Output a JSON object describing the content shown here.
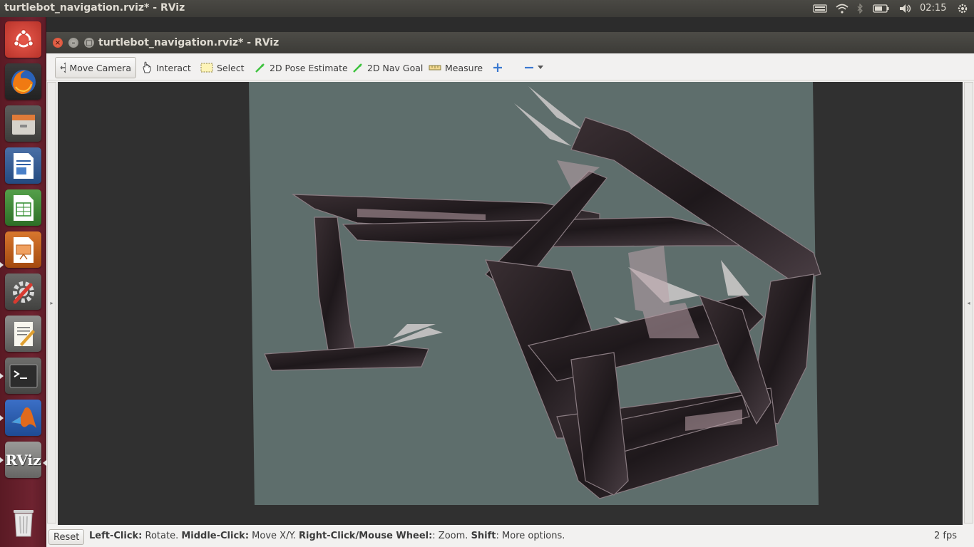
{
  "top_panel": {
    "title": "turtlebot_navigation.rviz* - RViz",
    "clock": "02:15",
    "tray_icons": [
      "keyboard-icon",
      "wifi-icon",
      "bluetooth-icon",
      "battery-icon",
      "volume-icon",
      "settings-gear-icon"
    ]
  },
  "launcher": {
    "items": [
      {
        "name": "ubuntu-dash-icon"
      },
      {
        "name": "firefox-icon"
      },
      {
        "name": "file-manager-icon"
      },
      {
        "name": "libreoffice-writer-icon"
      },
      {
        "name": "libreoffice-calc-icon"
      },
      {
        "name": "libreoffice-impress-icon"
      },
      {
        "name": "system-settings-icon"
      },
      {
        "name": "text-editor-icon"
      },
      {
        "name": "terminal-icon"
      },
      {
        "name": "matlab-icon"
      },
      {
        "name": "rviz-icon",
        "label": "RViz"
      },
      {
        "name": "trash-icon"
      }
    ]
  },
  "window": {
    "title": "turtlebot_navigation.rviz* - RViz"
  },
  "toolbar": {
    "move_camera": "Move Camera",
    "interact": "Interact",
    "select": "Select",
    "pose_estimate": "2D Pose Estimate",
    "nav_goal": "2D Nav Goal",
    "measure": "Measure"
  },
  "statusbar": {
    "reset": "Reset",
    "left_click_key": "Left-Click:",
    "left_click_val": " Rotate. ",
    "middle_click_key": "Middle-Click:",
    "middle_click_val": " Move X/Y. ",
    "right_click_key": "Right-Click/Mouse Wheel:",
    "right_click_val": ": Zoom. ",
    "shift_key": "Shift",
    "shift_val": ": More options.",
    "fps": "2 fps"
  },
  "colors": {
    "launcher_bg": "#6e2330",
    "viewport_bg": "#303030",
    "map_floor": "#5e6e6c",
    "map_walls": "#2a2226",
    "accent_green": "#3cc23c"
  }
}
